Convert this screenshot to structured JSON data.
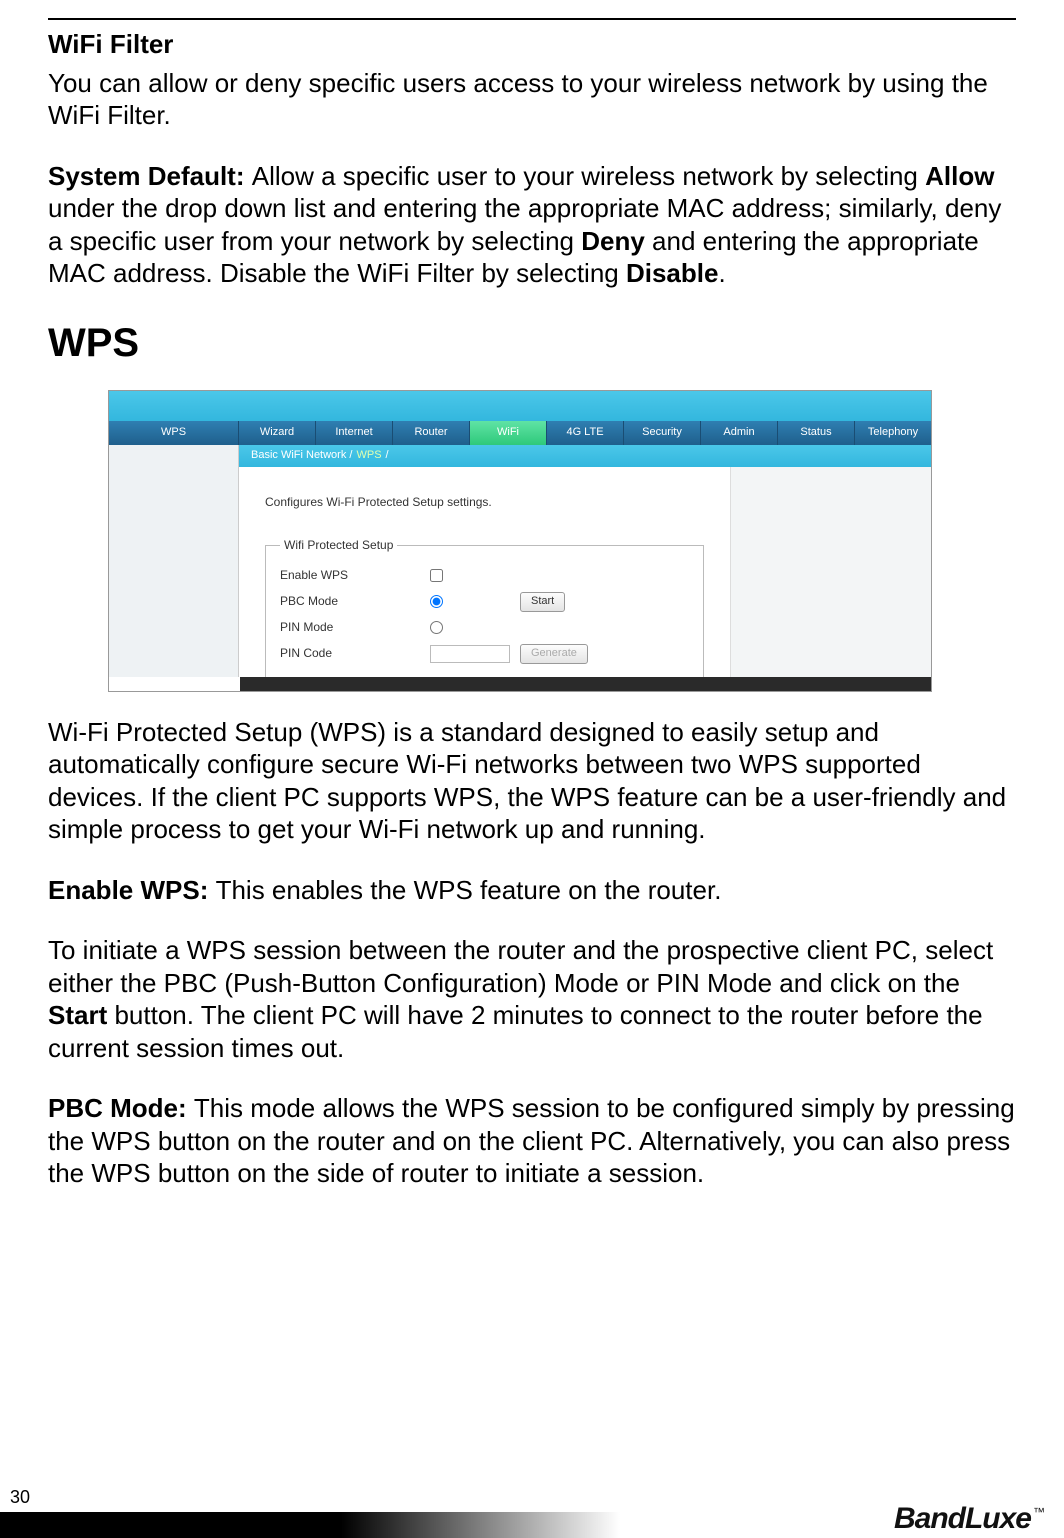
{
  "page_number": "30",
  "wifi_filter": {
    "heading": "WiFi Filter",
    "intro": "You can allow or deny specific users access to your wireless network by using the WiFi Filter.",
    "sysdef_label": "System Default: ",
    "sysdef_1": "Allow a specific user to your wireless network by selecting ",
    "allow": "Allow",
    "sysdef_2": " under the drop down list and entering the appropriate MAC address; similarly, deny a specific user from your network by selecting ",
    "deny": "Deny",
    "sysdef_3": " and entering the appropriate MAC address. Disable the WiFi Filter by selecting ",
    "disable": "Disable",
    "sysdef_4": "."
  },
  "wps": {
    "heading": "WPS",
    "para1": "Wi-Fi Protected Setup (WPS) is a standard designed to easily setup and automatically configure secure Wi-Fi networks between two WPS supported devices. If the client PC supports WPS, the WPS feature can be a user-friendly and simple process to get your Wi-Fi network up and running.",
    "enable_label": "Enable WPS: ",
    "enable_text": "This enables the WPS feature on the router.",
    "para2a": "To initiate a WPS session between the router and the prospective client PC, select either the PBC (Push-Button Configuration) Mode or PIN Mode and click on the ",
    "start_bold": "Start",
    "para2b": " button. The client PC will have 2 minutes to connect to the router before the current session times out.",
    "pbc_label": "PBC Mode: ",
    "pbc_text": "This mode allows the WPS session to be configured simply by pressing the WPS button on the router and on the client PC. Alternatively, you can also press the WPS button on the side of router to initiate a session."
  },
  "router_ui": {
    "side_label": "WPS",
    "tabs": [
      "Wizard",
      "Internet",
      "Router",
      "WiFi",
      "4G LTE",
      "Security",
      "Admin",
      "Status",
      "Telephony"
    ],
    "active_tab_index": 3,
    "breadcrumb_prefix": "Basic WiFi Network  /  ",
    "breadcrumb_active": "WPS",
    "breadcrumb_suffix": " /",
    "desc": "Configures Wi-Fi Protected Setup settings.",
    "legend": "Wifi Protected Setup",
    "row_enable": "Enable WPS",
    "row_pbc": "PBC Mode",
    "row_pin": "PIN Mode",
    "row_pincode": "PIN Code",
    "btn_start": "Start",
    "btn_generate": "Generate"
  },
  "brand": {
    "name": "BandLuxe",
    "tm": "™"
  }
}
